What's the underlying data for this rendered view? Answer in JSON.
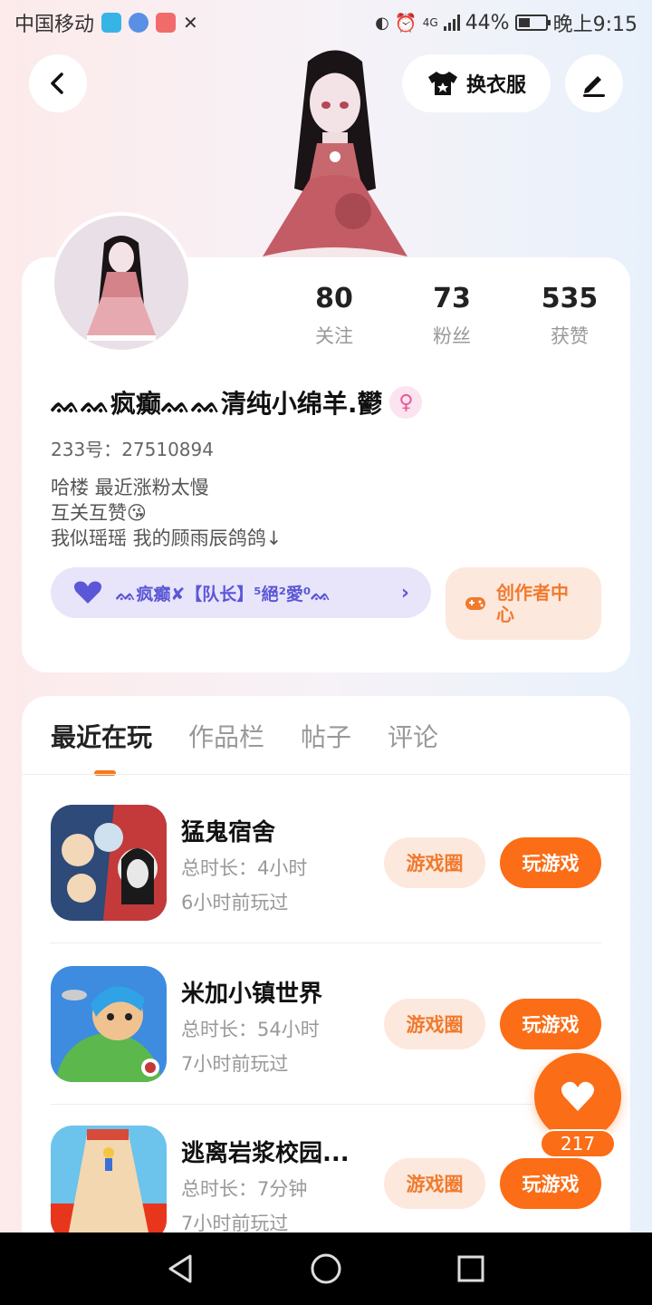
{
  "status_bar": {
    "carrier": "中国移动",
    "network": "4G",
    "battery": "44%",
    "battery_level": 0.44,
    "time": "晚上9:15"
  },
  "header": {
    "back_icon": "chevron-left-icon",
    "outfit_label": "换衣服",
    "outfit_icon": "shirt-icon",
    "edit_icon": "pen-icon"
  },
  "profile": {
    "stats": [
      {
        "value": "80",
        "label": "关注"
      },
      {
        "value": "73",
        "label": "粉丝"
      },
      {
        "value": "535",
        "label": "获赞"
      }
    ],
    "nickname": "ᨐᨐ疯癫ᨐᨐ清纯小绵羊.鬰",
    "gender_icon": "female-icon",
    "uid_label": "233号：",
    "uid_value": "27510894",
    "bio": [
      "哈楼 最近涨粉太慢",
      "互关互赞😘",
      "我似瑶瑶 我的顾雨辰鸽鸽↓"
    ],
    "guild_name": "ᨐ疯癫✘【队长】⁵絕²愛⁰ᨐ",
    "creator_label": "创作者中心",
    "accent_color": "#fb6d16",
    "guild_color": "#5c57d6"
  },
  "tabs": [
    {
      "label": "最近在玩",
      "active": true
    },
    {
      "label": "作品栏",
      "active": false
    },
    {
      "label": "帖子",
      "active": false
    },
    {
      "label": "评论",
      "active": false
    }
  ],
  "games": [
    {
      "name": "猛鬼宿舍",
      "duration": "总时长：4小时",
      "last_played": "6小时前玩过"
    },
    {
      "name": "米加小镇世界",
      "duration": "总时长：54小时",
      "last_played": "7小时前玩过"
    },
    {
      "name": "逃离岩浆校园...",
      "duration": "总时长：7分钟",
      "last_played": "7小时前玩过"
    }
  ],
  "game_buttons": {
    "circle_label": "游戏圈",
    "play_label": "玩游戏"
  },
  "like": {
    "count": "217",
    "icon": "heart-icon"
  },
  "nav": {
    "back": "triangle-back-icon",
    "home": "circle-home-icon",
    "recent": "square-recent-icon"
  }
}
